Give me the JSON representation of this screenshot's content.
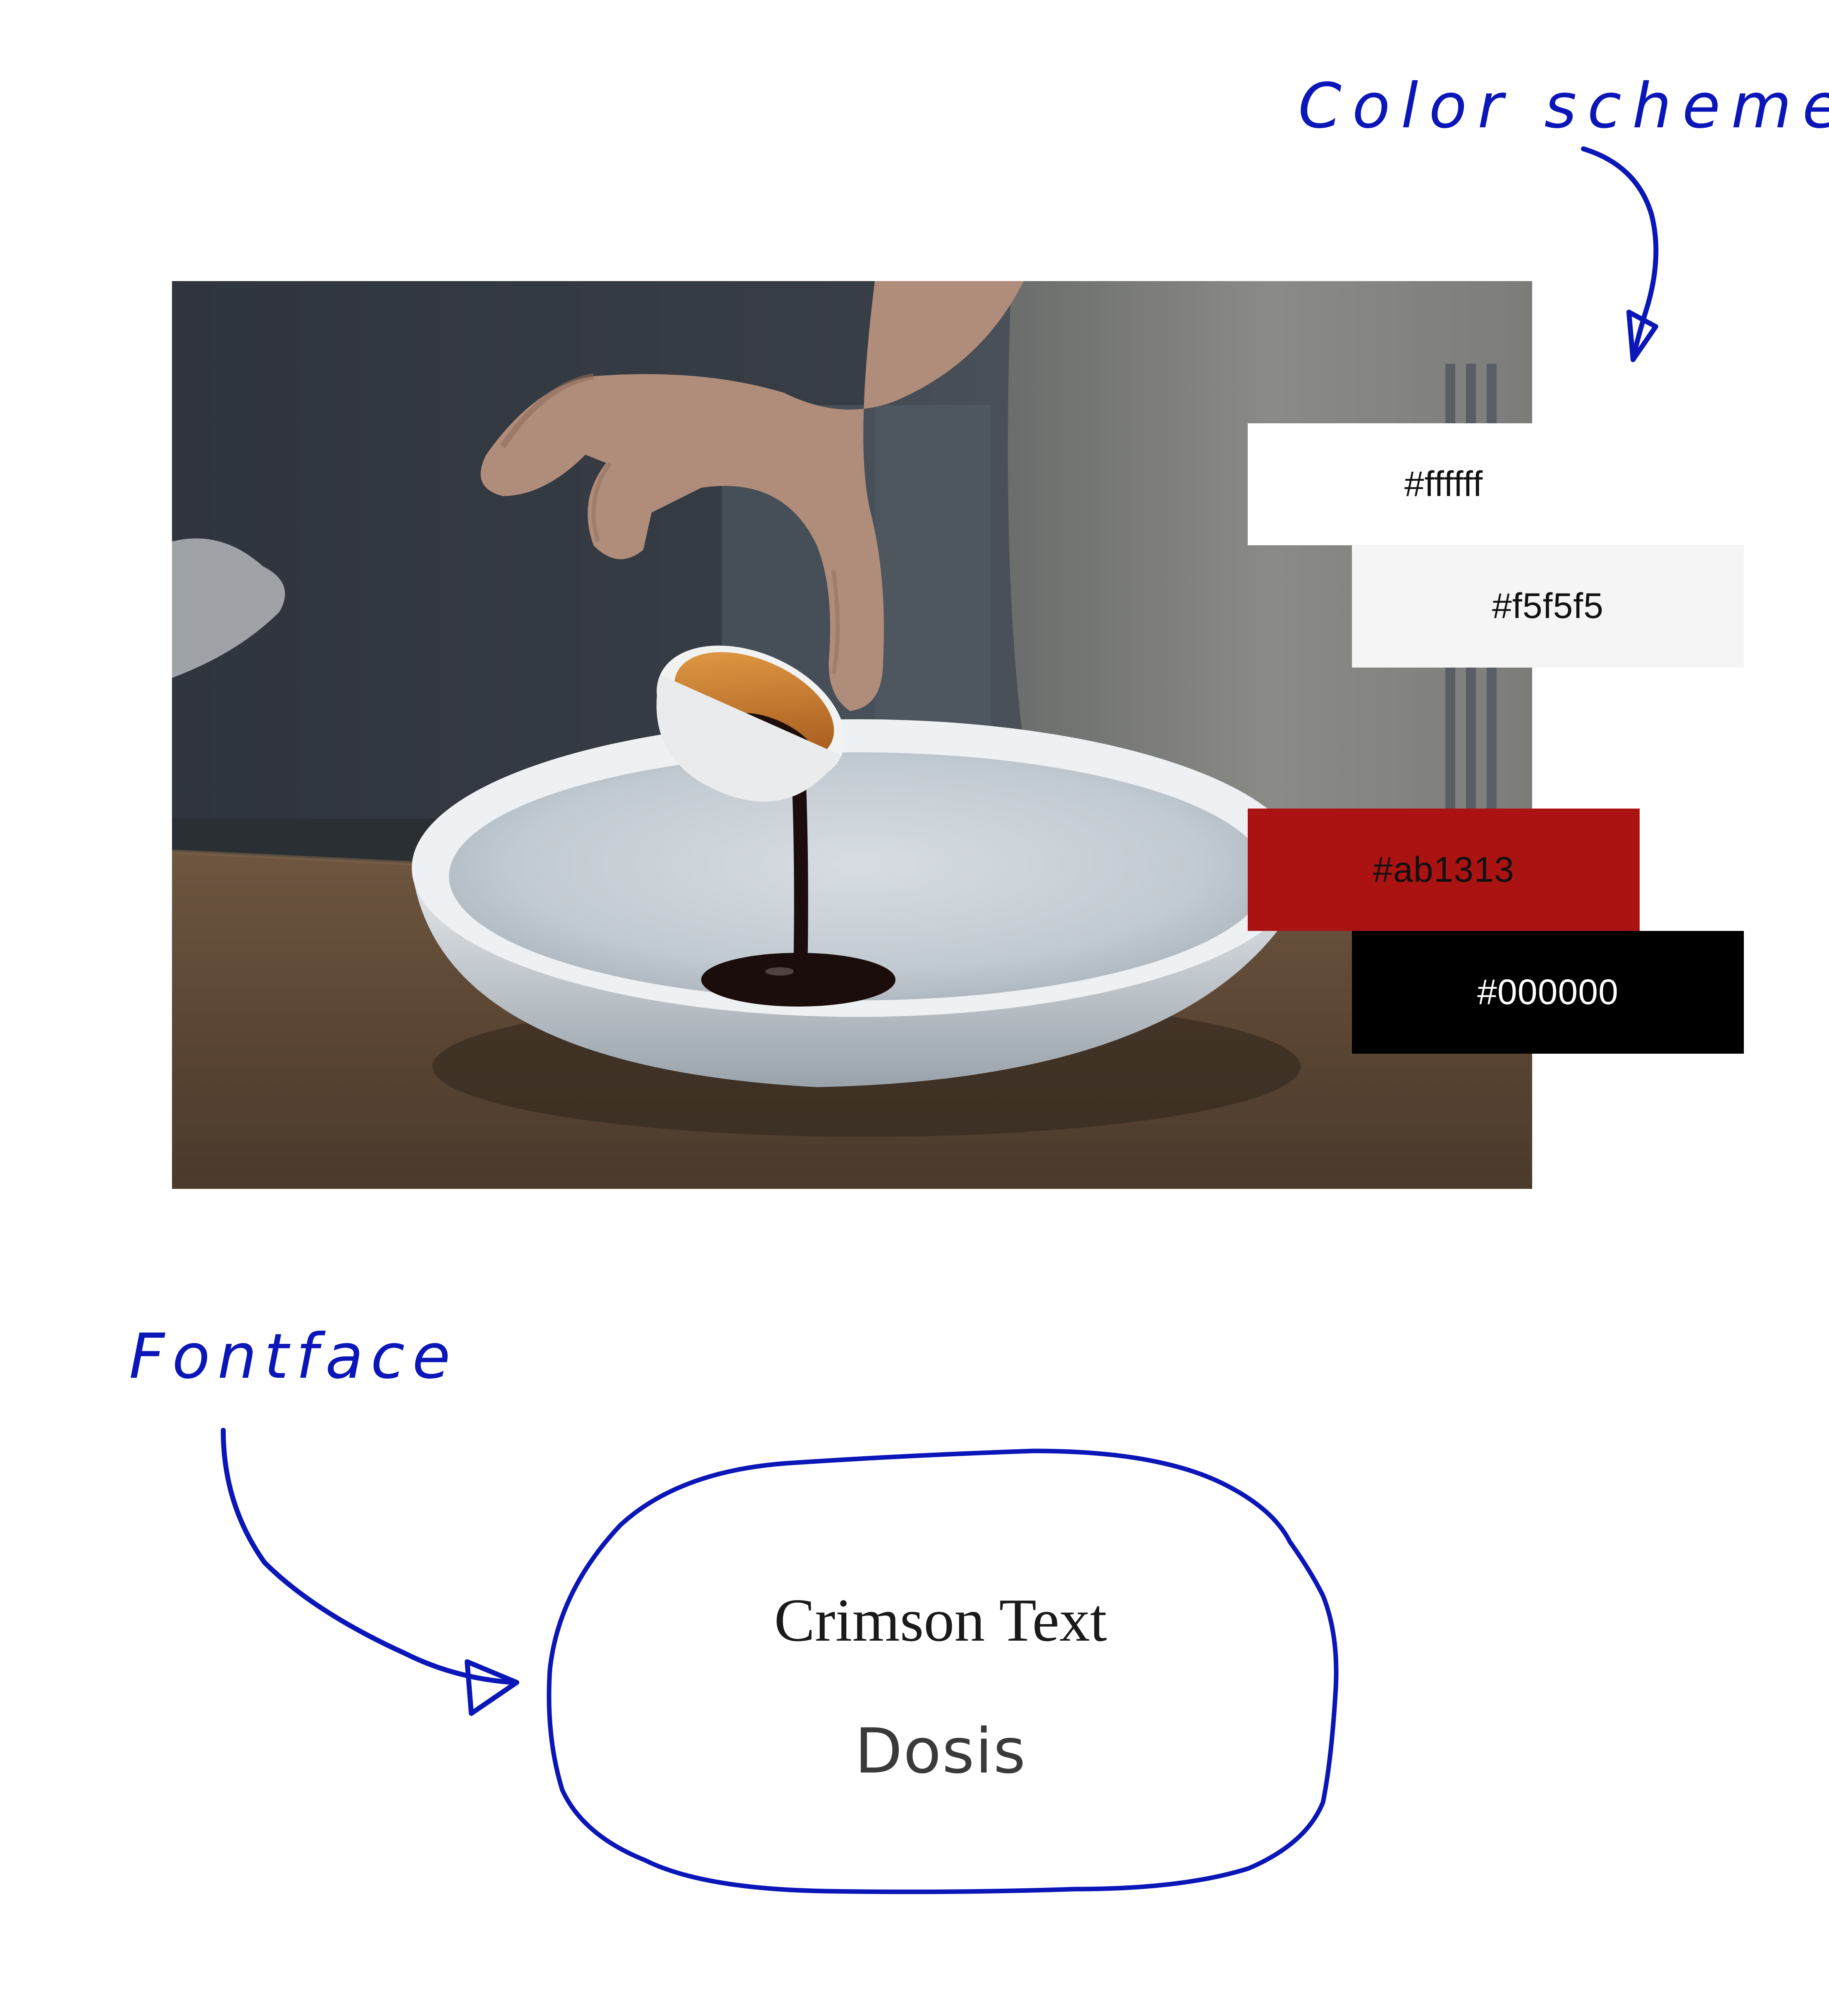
{
  "annotations": {
    "color_scheme_label": "Color scheme",
    "fontface_label": "Fontface"
  },
  "color_scheme": {
    "swatches": [
      {
        "label": "#ffffff",
        "color": "#ffffff"
      },
      {
        "label": "#f5f5f5",
        "color": "#f5f5f5"
      },
      {
        "label": "#ab1313",
        "color": "#ab1313"
      },
      {
        "label": "#000000",
        "color": "#000000"
      }
    ]
  },
  "fonts": {
    "primary": "Crimson Text",
    "secondary": "Dosis"
  },
  "colors": {
    "annotation_ink": "#0a16b8"
  }
}
